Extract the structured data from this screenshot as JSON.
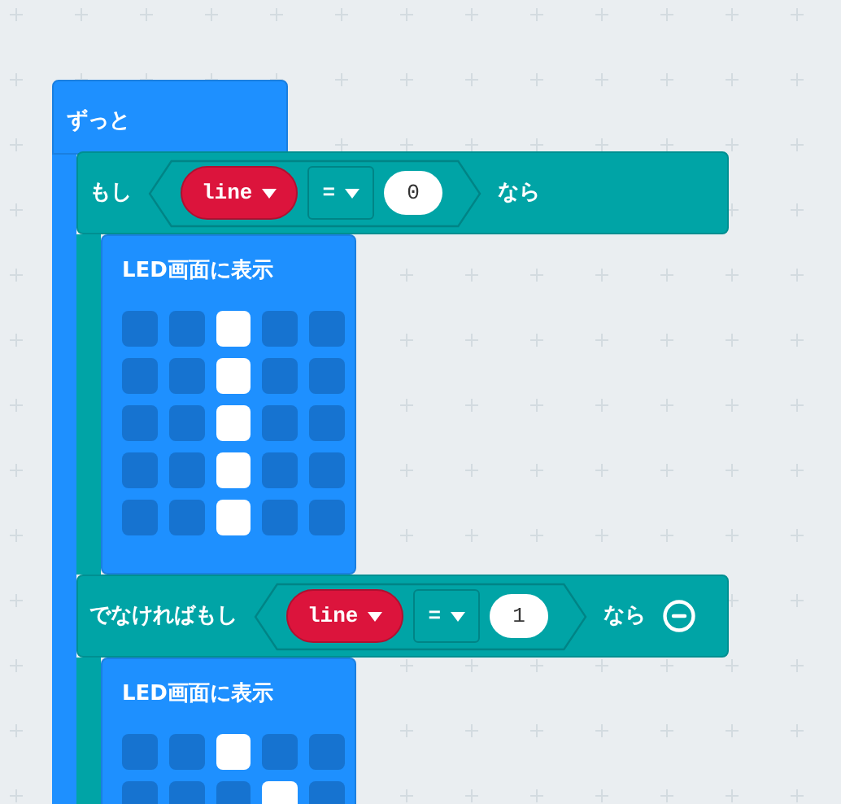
{
  "forever": {
    "label": "ずっと"
  },
  "if_block": {
    "branches": [
      {
        "keyword": "もし",
        "variable": "line",
        "operator": "=",
        "value": "0",
        "then": "なら",
        "removable": false,
        "body": {
          "label": "LED画面に表示",
          "rows": [
            {
              "cells": [
                {
                  "on": false
                },
                {
                  "on": false
                },
                {
                  "on": true
                },
                {
                  "on": false
                },
                {
                  "on": false
                }
              ]
            },
            {
              "cells": [
                {
                  "on": false
                },
                {
                  "on": false
                },
                {
                  "on": true
                },
                {
                  "on": false
                },
                {
                  "on": false
                }
              ]
            },
            {
              "cells": [
                {
                  "on": false
                },
                {
                  "on": false
                },
                {
                  "on": true
                },
                {
                  "on": false
                },
                {
                  "on": false
                }
              ]
            },
            {
              "cells": [
                {
                  "on": false
                },
                {
                  "on": false
                },
                {
                  "on": true
                },
                {
                  "on": false
                },
                {
                  "on": false
                }
              ]
            },
            {
              "cells": [
                {
                  "on": false
                },
                {
                  "on": false
                },
                {
                  "on": true
                },
                {
                  "on": false
                },
                {
                  "on": false
                }
              ]
            }
          ]
        }
      },
      {
        "keyword": "でなければもし",
        "variable": "line",
        "operator": "=",
        "value": "1",
        "then": "なら",
        "removable": true,
        "body": {
          "label": "LED画面に表示",
          "rows": [
            {
              "cells": [
                {
                  "on": false
                },
                {
                  "on": false
                },
                {
                  "on": true
                },
                {
                  "on": false
                },
                {
                  "on": false
                }
              ]
            },
            {
              "cells": [
                {
                  "on": false
                },
                {
                  "on": false
                },
                {
                  "on": false
                },
                {
                  "on": true
                },
                {
                  "on": false
                }
              ]
            }
          ]
        }
      }
    ]
  }
}
